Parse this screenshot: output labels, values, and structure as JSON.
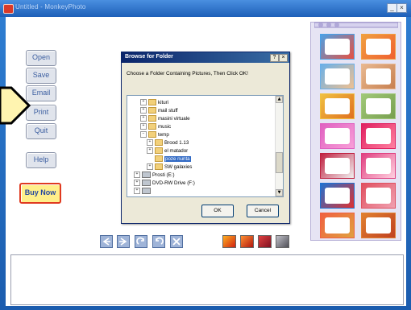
{
  "window": {
    "title": "Untitled - MonkeyPhoto",
    "min_label": "_",
    "max_label": "□",
    "close_label": "×"
  },
  "sidebar": {
    "items": [
      {
        "label": "Open"
      },
      {
        "label": "Save"
      },
      {
        "label": "Email"
      },
      {
        "label": "Print"
      },
      {
        "label": "Quit"
      },
      {
        "label": "Help"
      }
    ],
    "buy_label": "Buy Now"
  },
  "dialog": {
    "title": "Browse for Folder",
    "help_label": "?",
    "close_label": "×",
    "instruction": "Choose a Folder Containing Pictures, Then Click OK!",
    "tree": [
      {
        "label": "kituri",
        "indent": 2,
        "exp": "+"
      },
      {
        "label": "mail stuff",
        "indent": 2,
        "exp": "+"
      },
      {
        "label": "masini virtuale",
        "indent": 2,
        "exp": "+"
      },
      {
        "label": "music",
        "indent": 2,
        "exp": "+"
      },
      {
        "label": "temp",
        "indent": 2,
        "exp": "−"
      },
      {
        "label": "Brood 1.13",
        "indent": 3,
        "exp": "+"
      },
      {
        "label": "el matador",
        "indent": 3,
        "exp": "+"
      },
      {
        "label": "poze nunta",
        "indent": 3,
        "exp": "",
        "selected": true
      },
      {
        "label": "SW galaxies",
        "indent": 3,
        "exp": "+"
      },
      {
        "label": "Prosti (E:)",
        "indent": 1,
        "exp": "+",
        "drive": true
      },
      {
        "label": "DVD-RW Drive (F:)",
        "indent": 1,
        "exp": "+",
        "drive": true
      },
      {
        "label": "",
        "indent": 1,
        "exp": "+",
        "drive": true
      }
    ],
    "ok_label": "OK",
    "cancel_label": "Cancel"
  },
  "toolbar": {
    "tools": [
      "back-icon",
      "forward-icon",
      "rotate-right-icon",
      "rotate-left-icon",
      "delete-icon"
    ],
    "effects": [
      "effect-fire-icon",
      "effect-fire2-icon",
      "effect-red-icon",
      "effect-gray-icon"
    ]
  },
  "frames": {
    "thumbs": [
      {
        "border": "#4aa0e6",
        "accent": "#e85040"
      },
      {
        "border": "#f0a040",
        "accent": "#f06030"
      },
      {
        "border": "#6ab0e8",
        "accent": "#f0c090"
      },
      {
        "border": "#e8b890",
        "accent": "#c88050"
      },
      {
        "border": "#f0c040",
        "accent": "#e07020"
      },
      {
        "border": "#a0c878",
        "accent": "#78a050"
      },
      {
        "border": "#e060c0",
        "accent": "#f8a0d8"
      },
      {
        "border": "#e02060",
        "accent": "#ff80a0"
      },
      {
        "border": "#c02040",
        "accent": "#f0f0f0"
      },
      {
        "border": "#e04080",
        "accent": "#ffd0e0"
      },
      {
        "border": "#2070d0",
        "accent": "#e03030"
      },
      {
        "border": "#e05060",
        "accent": "#f0a0b0"
      },
      {
        "border": "#f06040",
        "accent": "#e0a040"
      },
      {
        "border": "#e08030",
        "accent": "#c04020"
      }
    ]
  },
  "colors": {
    "window_blue": "#1d62b6",
    "buy_border": "#e03a20",
    "buy_fill": "#ffef8a",
    "selection": "#316ac5"
  }
}
